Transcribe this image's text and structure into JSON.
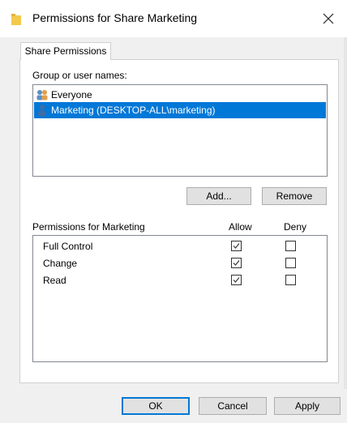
{
  "window": {
    "title": "Permissions for Share Marketing"
  },
  "tabs": [
    {
      "label": "Share Permissions"
    }
  ],
  "users": {
    "label": "Group or user names:",
    "items": [
      {
        "name": "Everyone",
        "selected": false
      },
      {
        "name": "Marketing (DESKTOP-ALL\\marketing)",
        "selected": true
      }
    ],
    "add_label": "Add...",
    "remove_label": "Remove"
  },
  "permissions": {
    "title": "Permissions for Marketing",
    "allow_header": "Allow",
    "deny_header": "Deny",
    "rows": [
      {
        "name": "Full Control",
        "allow": true,
        "deny": false
      },
      {
        "name": "Change",
        "allow": true,
        "deny": false
      },
      {
        "name": "Read",
        "allow": true,
        "deny": false
      }
    ]
  },
  "footer": {
    "ok_label": "OK",
    "cancel_label": "Cancel",
    "apply_label": "Apply"
  },
  "colors": {
    "selection": "#0078d7",
    "folder": "#f2c94c"
  },
  "icons": {
    "title": "folder-icon",
    "close": "close-icon",
    "group": "group-users-icon",
    "user": "user-icon",
    "checkbox_checked": "checkmark-icon"
  }
}
